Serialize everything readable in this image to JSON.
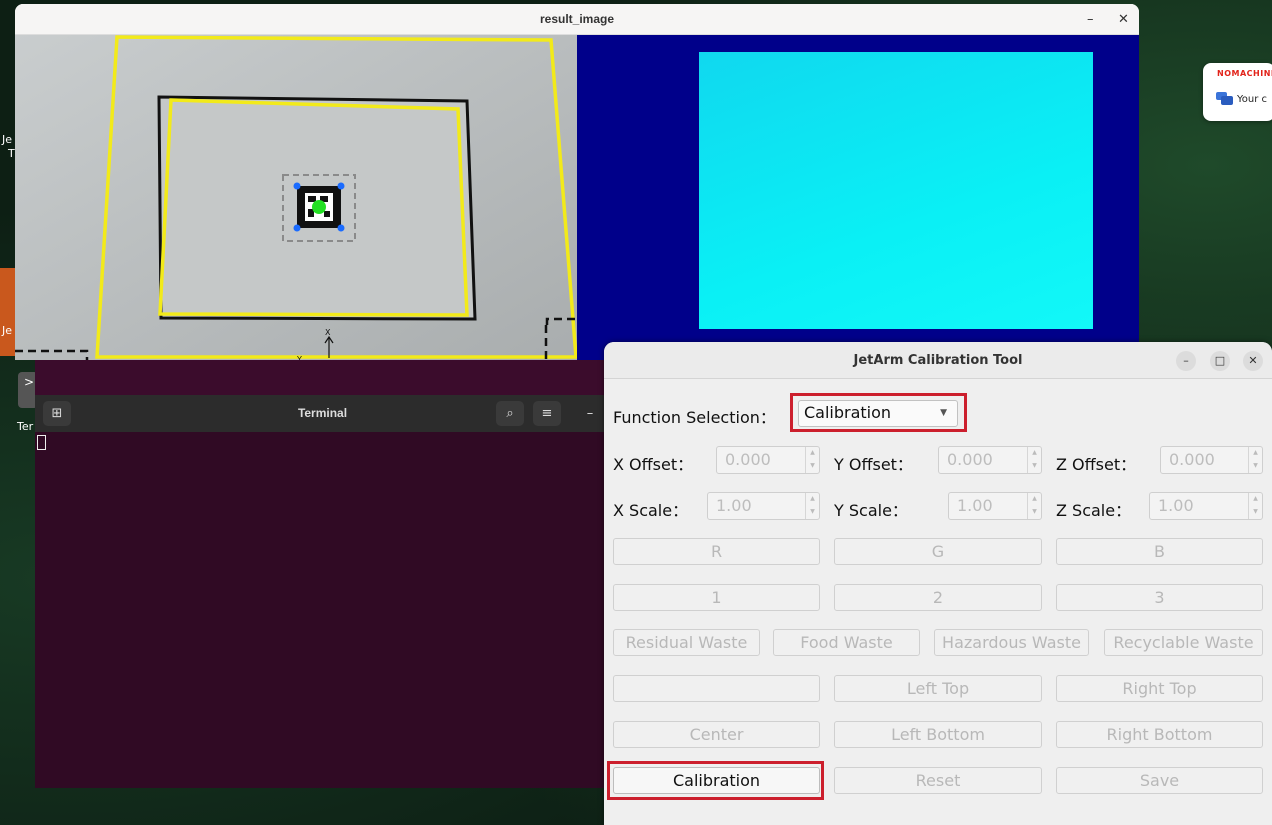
{
  "desktop": {
    "side_labels": [
      "Je",
      "T",
      "Je",
      "Ter"
    ],
    "dock_tile_symbol": ">",
    "nomachine": {
      "brand": "NOMACHINE",
      "message": "Your c"
    }
  },
  "result_window": {
    "title": "result_image",
    "minimize": "–",
    "close": "✕",
    "axis_x_label": "X",
    "axis_y_label": "Y"
  },
  "terminal": {
    "title": "Terminal",
    "new_tab_icon": "⊞",
    "search_icon": "⌕",
    "menu_icon": "≡",
    "minimize": "–"
  },
  "calib_tool": {
    "title": "JetArm Calibration Tool",
    "window_controls": [
      "–",
      "□",
      "✕"
    ],
    "function_label": "Function Selection：",
    "function_value": "Calibration",
    "offsets": [
      {
        "label": "X Offset：",
        "value": "0.000"
      },
      {
        "label": "Y Offset：",
        "value": "0.000"
      },
      {
        "label": "Z Offset：",
        "value": "0.000"
      }
    ],
    "scales": [
      {
        "label": "X Scale：",
        "value": "1.00"
      },
      {
        "label": "Y Scale：",
        "value": "1.00"
      },
      {
        "label": "Z Scale：",
        "value": "1.00"
      }
    ],
    "rgb_buttons": [
      "R",
      "G",
      "B"
    ],
    "num_buttons": [
      "1",
      "2",
      "3"
    ],
    "waste_buttons": [
      "Residual Waste",
      "Food Waste",
      "Hazardous Waste",
      "Recyclable Waste"
    ],
    "corner_row1": [
      "",
      "Left Top",
      "Right Top"
    ],
    "corner_row2": [
      "Center",
      "Left Bottom",
      "Right Bottom"
    ],
    "action_buttons": [
      "Calibration",
      "Reset",
      "Save"
    ]
  },
  "colors": {
    "highlight": "#cc1f2d",
    "yellow_frame": "#f2ea1a",
    "terminal_bg": "#300a24",
    "blue_panel": "#00008a",
    "cyan": "#0af0f5"
  }
}
